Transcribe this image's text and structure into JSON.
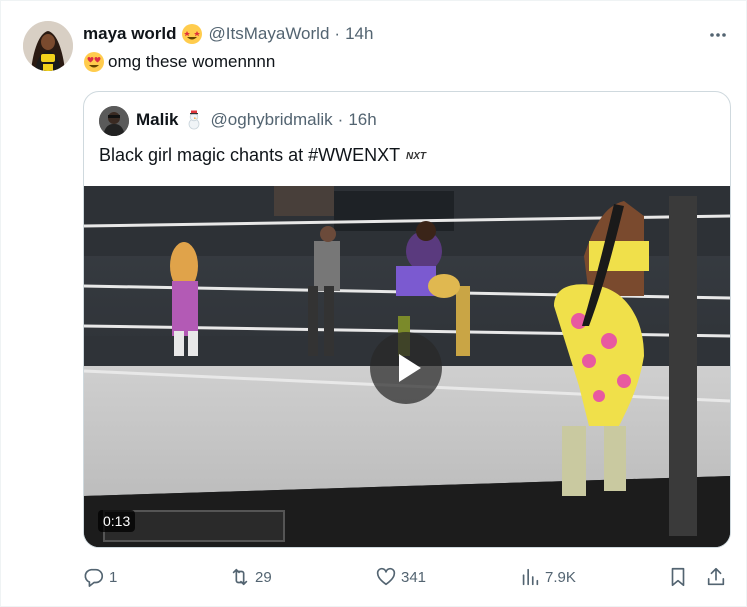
{
  "tweet": {
    "author_name": "maya world",
    "author_emoji": "star-struck-emoji",
    "handle": "@ItsMayaWorld",
    "separator": "·",
    "time": "14h",
    "text": "omg these womennnn",
    "text_emoji": "heart-eyes-emoji",
    "more_icon": "more-icon"
  },
  "quote": {
    "author_name": "Malik",
    "author_emoji": "snowman-emoji",
    "handle": "@oghybridmalik",
    "separator": "·",
    "time": "16h",
    "text": "Black girl magic chants at #WWENXT",
    "hashtag_logo": "NXT",
    "video": {
      "duration": "0:13",
      "play_icon": "play-icon"
    }
  },
  "actions": {
    "reply_count": "1",
    "retweet_count": "29",
    "like_count": "341",
    "view_count": "7.9K"
  },
  "colors": {
    "text_primary": "#0f1419",
    "text_secondary": "#536471",
    "border": "#cfd9de"
  }
}
